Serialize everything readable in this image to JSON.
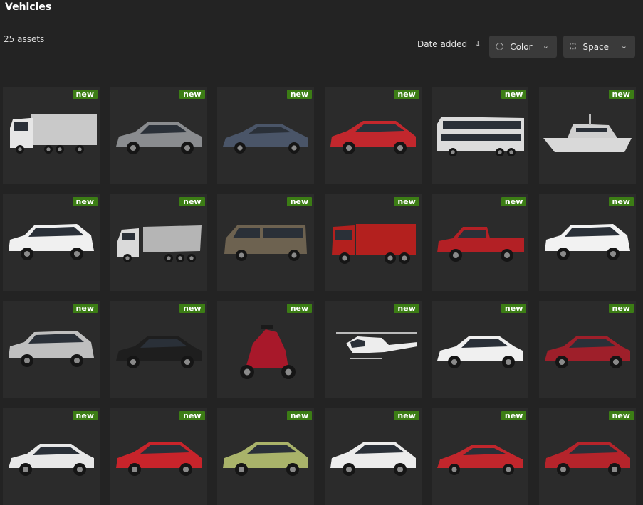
{
  "header": {
    "title": "Vehicles",
    "asset_count": "25 assets"
  },
  "toolbar": {
    "sort_label": "Date added",
    "color_filter_label": "Color",
    "space_filter_label": "Space"
  },
  "badge_label": "new",
  "assets": [
    {
      "kind": "truck",
      "color": "#c9c9c9"
    },
    {
      "kind": "sedan",
      "color": "#8a8c8f"
    },
    {
      "kind": "coupe",
      "color": "#4a5568"
    },
    {
      "kind": "hatch",
      "color": "#c2272d"
    },
    {
      "kind": "bus",
      "color": "#dcdcdc"
    },
    {
      "kind": "boat",
      "color": "#d9d9d9"
    },
    {
      "kind": "suv",
      "color": "#f0f0f0"
    },
    {
      "kind": "dump",
      "color": "#b5b5b5"
    },
    {
      "kind": "van",
      "color": "#6d6250"
    },
    {
      "kind": "fire",
      "color": "#b3201e"
    },
    {
      "kind": "pickup",
      "color": "#b32025"
    },
    {
      "kind": "suv",
      "color": "#f2f2f2"
    },
    {
      "kind": "suv",
      "color": "#bfbfbf"
    },
    {
      "kind": "sedan",
      "color": "#1e1e1e"
    },
    {
      "kind": "moto",
      "color": "#a8182a"
    },
    {
      "kind": "heli",
      "color": "#ededed"
    },
    {
      "kind": "sedan",
      "color": "#f0f0f0"
    },
    {
      "kind": "sedan",
      "color": "#9e1f2a"
    },
    {
      "kind": "sedan",
      "color": "#e8e8e8"
    },
    {
      "kind": "hatch",
      "color": "#c8242b"
    },
    {
      "kind": "hatch",
      "color": "#a9b36a"
    },
    {
      "kind": "hatch",
      "color": "#ececec"
    },
    {
      "kind": "coupe",
      "color": "#c1262c"
    },
    {
      "kind": "hatch",
      "color": "#b5242b"
    }
  ]
}
